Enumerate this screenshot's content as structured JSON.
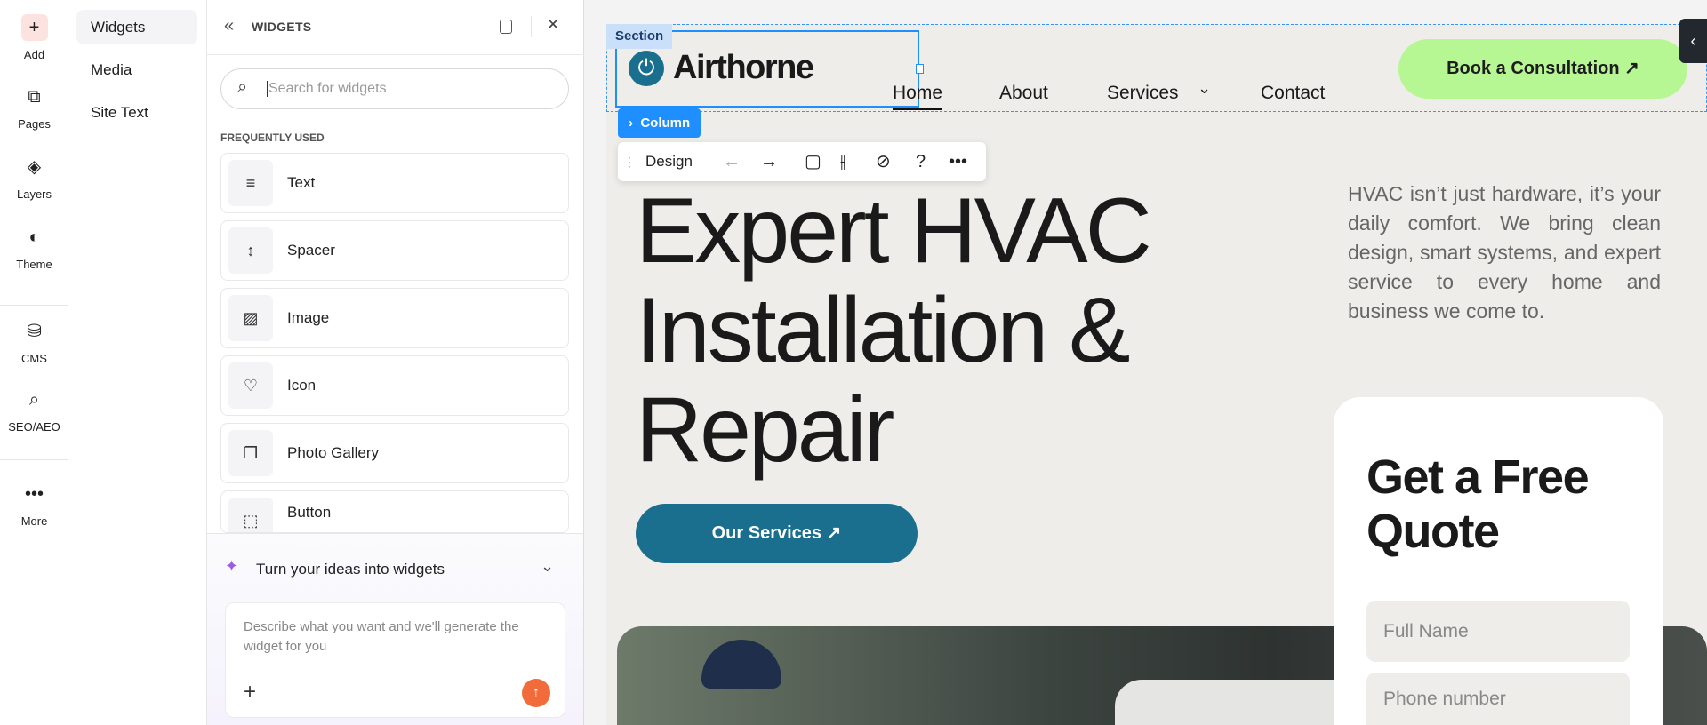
{
  "rail": {
    "items": [
      {
        "label": "Add",
        "icon": "plus-icon"
      },
      {
        "label": "Pages",
        "icon": "pages-icon"
      },
      {
        "label": "Layers",
        "icon": "layers-icon"
      },
      {
        "label": "Theme",
        "icon": "theme-icon"
      },
      {
        "label": "CMS",
        "icon": "database-icon"
      },
      {
        "label": "SEO/AEO",
        "icon": "seo-icon"
      },
      {
        "label": "More",
        "icon": "more-icon"
      }
    ]
  },
  "subnav": {
    "items": [
      "Widgets",
      "Media",
      "Site Text"
    ]
  },
  "panel": {
    "title": "WIDGETS",
    "search_placeholder": "Search for widgets",
    "section": "FREQUENTLY USED",
    "widgets": [
      {
        "label": "Text"
      },
      {
        "label": "Spacer"
      },
      {
        "label": "Image"
      },
      {
        "label": "Icon"
      },
      {
        "label": "Photo Gallery"
      },
      {
        "label": "Button"
      }
    ],
    "ai": {
      "title": "Turn your ideas into widgets",
      "placeholder": "Describe what you want and we'll generate the widget for you"
    }
  },
  "editor": {
    "section_label": "Section",
    "column_label": "Column",
    "toolbar_design": "Design",
    "toolbar_help": "?"
  },
  "site": {
    "logo": "Airthorne",
    "nav": [
      "Home",
      "About",
      "Services",
      "Contact"
    ],
    "cta": "Book a Consultation",
    "headline": [
      "Expert HVAC",
      "Installation &",
      "Repair"
    ],
    "intro": "HVAC isn’t just hardware, it’s your daily comfort. We bring clean design, smart systems, and expert service to every home and business we come to.",
    "services_button": "Our Services",
    "quote_title": "Get a Free Quote",
    "fields": [
      "Full Name",
      "Phone number"
    ]
  },
  "colors": {
    "accent": "#1f8fff",
    "cta": "#b6f794",
    "brand": "#1a6e8e",
    "send": "#f26b3a"
  }
}
